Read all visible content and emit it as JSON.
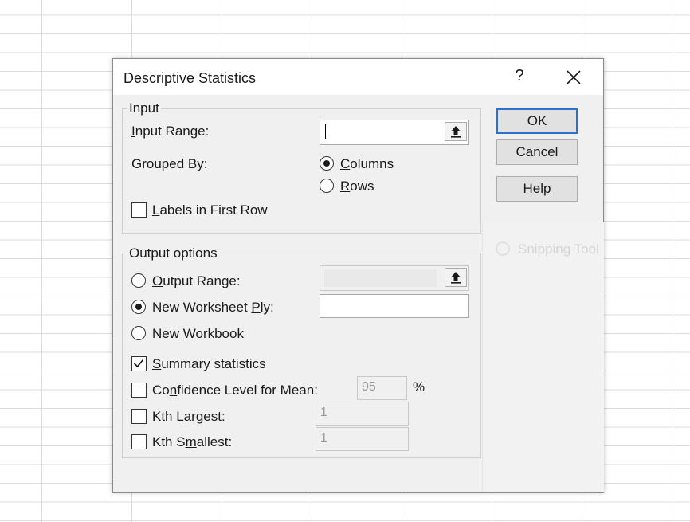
{
  "dialog": {
    "title": "Descriptive Statistics",
    "help_glyph": "?"
  },
  "input_group": {
    "legend": "Input",
    "input_range_label": "Input Range:",
    "input_range_value": "",
    "grouped_by_label": "Grouped By:",
    "columns_label": "Columns",
    "rows_label": "Rows",
    "grouped_by_selected": "Columns",
    "labels_first_row_label": "Labels in First Row",
    "labels_first_row_checked": false
  },
  "output_group": {
    "legend": "Output options",
    "output_range_label": "Output Range:",
    "new_worksheet_label": "New Worksheet Ply:",
    "new_workbook_label": "New Workbook",
    "selected": "New Worksheet Ply",
    "summary_stats_label": "Summary statistics",
    "summary_stats_checked": true,
    "confidence_label": "Confidence Level for Mean:",
    "confidence_value": "95",
    "percent": "%",
    "kth_largest_label": "Kth Largest:",
    "kth_largest_value": "1",
    "kth_smallest_label": "Kth Smallest:",
    "kth_smallest_value": "1"
  },
  "buttons": {
    "ok": "OK",
    "cancel": "Cancel",
    "help": "Help"
  },
  "background": {
    "snipping_tool_text": "Snipping Tool"
  },
  "colors": {
    "default_button_border": "#2c6fcc",
    "dialog_bg": "#f0f0f0"
  }
}
